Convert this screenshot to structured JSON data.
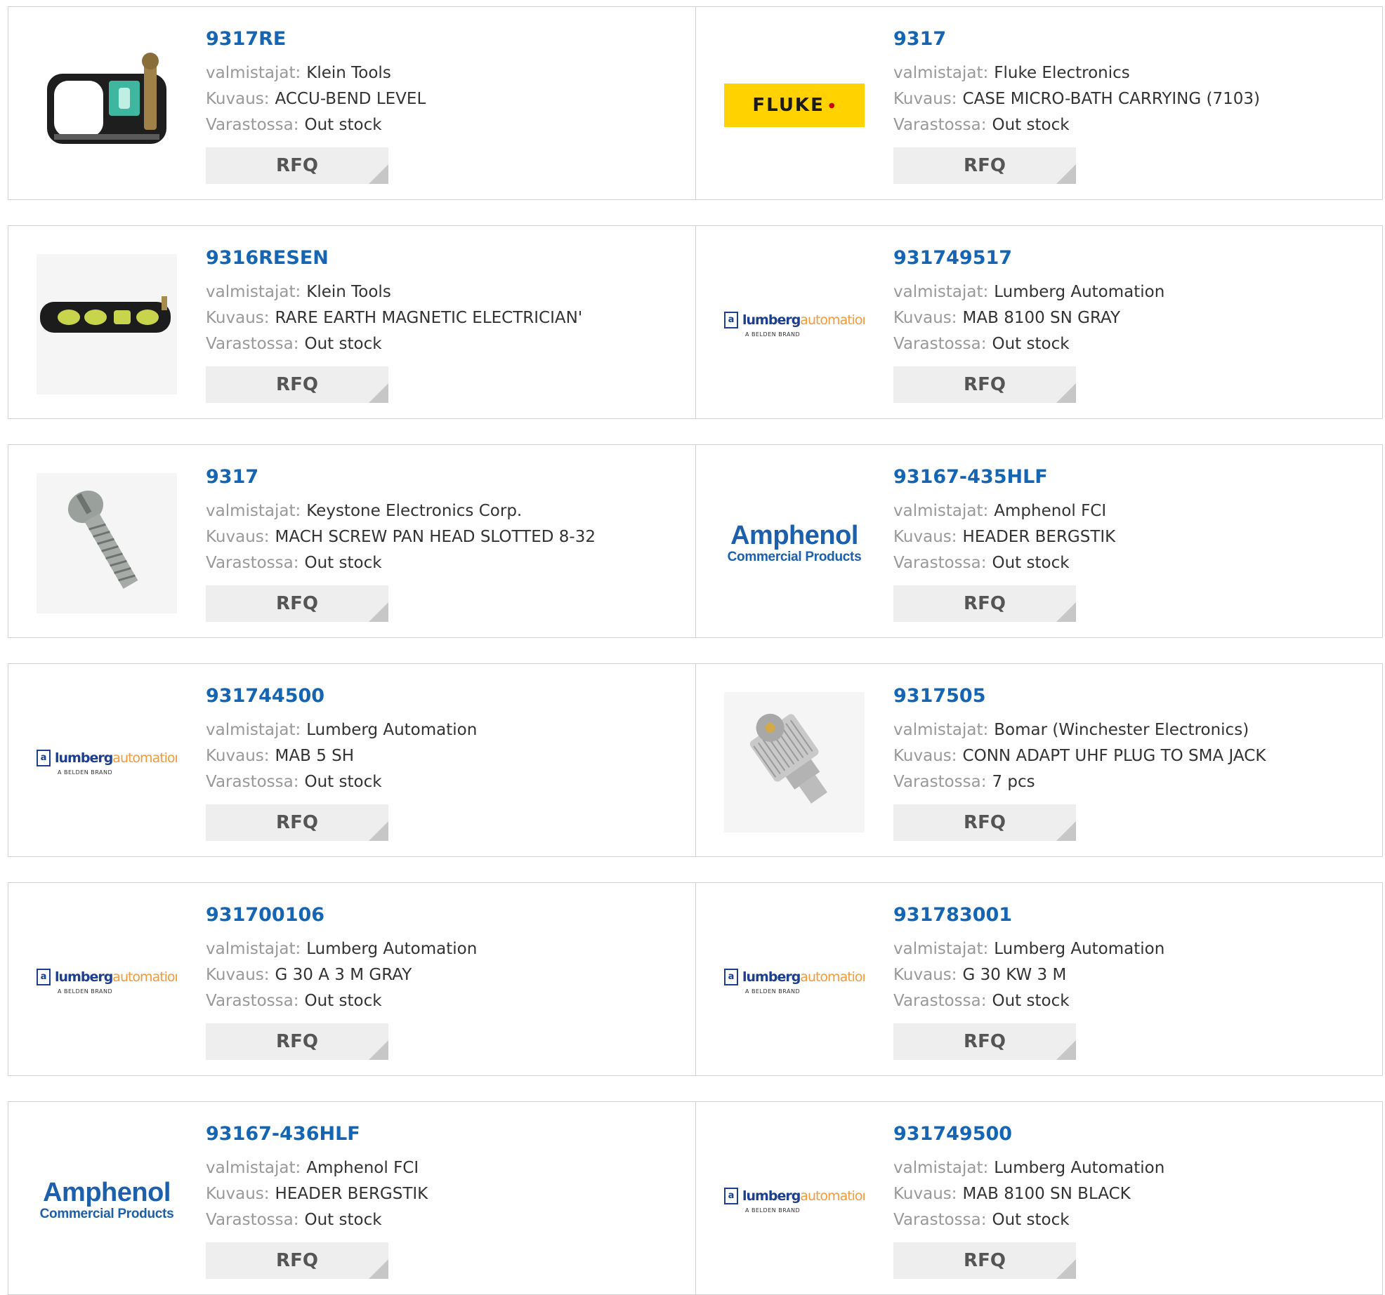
{
  "labels": {
    "manufacturer": "valmistajat:",
    "description": "Kuvaus:",
    "stock": "Varastossa:",
    "rfq": "RFQ"
  },
  "logos": {
    "fluke": "FLUKE",
    "lumberg_a": "lumberg",
    "lumberg_b": "automation",
    "lumberg_sub": "A BELDEN BRAND",
    "amphenol_1": "Amphenol",
    "amphenol_2": "Commercial Products"
  },
  "colors": {
    "link": "#1565b5",
    "label": "#999999",
    "value": "#333333",
    "button_bg": "#eeeeee",
    "border": "#d2d2d2",
    "fluke_yellow": "#ffd200",
    "lumberg_blue": "#1d3f8f",
    "lumberg_orange": "#f39a3c"
  },
  "products": [
    {
      "part": "9317RE",
      "manufacturer": "Klein Tools",
      "description": "ACCU-BEND LEVEL",
      "stock": "Out stock",
      "image": "level-tool-icon"
    },
    {
      "part": "9317",
      "manufacturer": "Fluke Electronics",
      "description": "CASE MICRO-BATH CARRYING (7103)",
      "stock": "Out stock",
      "image": "fluke-logo"
    },
    {
      "part": "9316RESEN",
      "manufacturer": "Klein Tools",
      "description": "RARE EARTH MAGNETIC ELECTRICIAN'",
      "stock": "Out stock",
      "image": "torpedo-level-icon"
    },
    {
      "part": "931749517",
      "manufacturer": "Lumberg Automation",
      "description": "MAB 8100 SN GRAY",
      "stock": "Out stock",
      "image": "lumberg-logo"
    },
    {
      "part": "9317",
      "manufacturer": "Keystone Electronics Corp.",
      "description": "MACH SCREW PAN HEAD SLOTTED 8-32",
      "stock": "Out stock",
      "image": "screw-icon"
    },
    {
      "part": "93167-435HLF",
      "manufacturer": "Amphenol FCI",
      "description": "HEADER BERGSTIK",
      "stock": "Out stock",
      "image": "amphenol-logo"
    },
    {
      "part": "931744500",
      "manufacturer": "Lumberg Automation",
      "description": "MAB 5 SH",
      "stock": "Out stock",
      "image": "lumberg-logo"
    },
    {
      "part": "9317505",
      "manufacturer": "Bomar (Winchester Electronics)",
      "description": "CONN ADAPT UHF PLUG TO SMA JACK",
      "stock": "7 pcs",
      "image": "uhf-adapter-icon"
    },
    {
      "part": "931700106",
      "manufacturer": "Lumberg Automation",
      "description": "G 30 A 3 M GRAY",
      "stock": "Out stock",
      "image": "lumberg-logo"
    },
    {
      "part": "931783001",
      "manufacturer": "Lumberg Automation",
      "description": "G 30 KW 3 M",
      "stock": "Out stock",
      "image": "lumberg-logo"
    },
    {
      "part": "93167-436HLF",
      "manufacturer": "Amphenol FCI",
      "description": "HEADER BERGSTIK",
      "stock": "Out stock",
      "image": "amphenol-logo"
    },
    {
      "part": "931749500",
      "manufacturer": "Lumberg Automation",
      "description": "MAB 8100 SN BLACK",
      "stock": "Out stock",
      "image": "lumberg-logo"
    }
  ]
}
